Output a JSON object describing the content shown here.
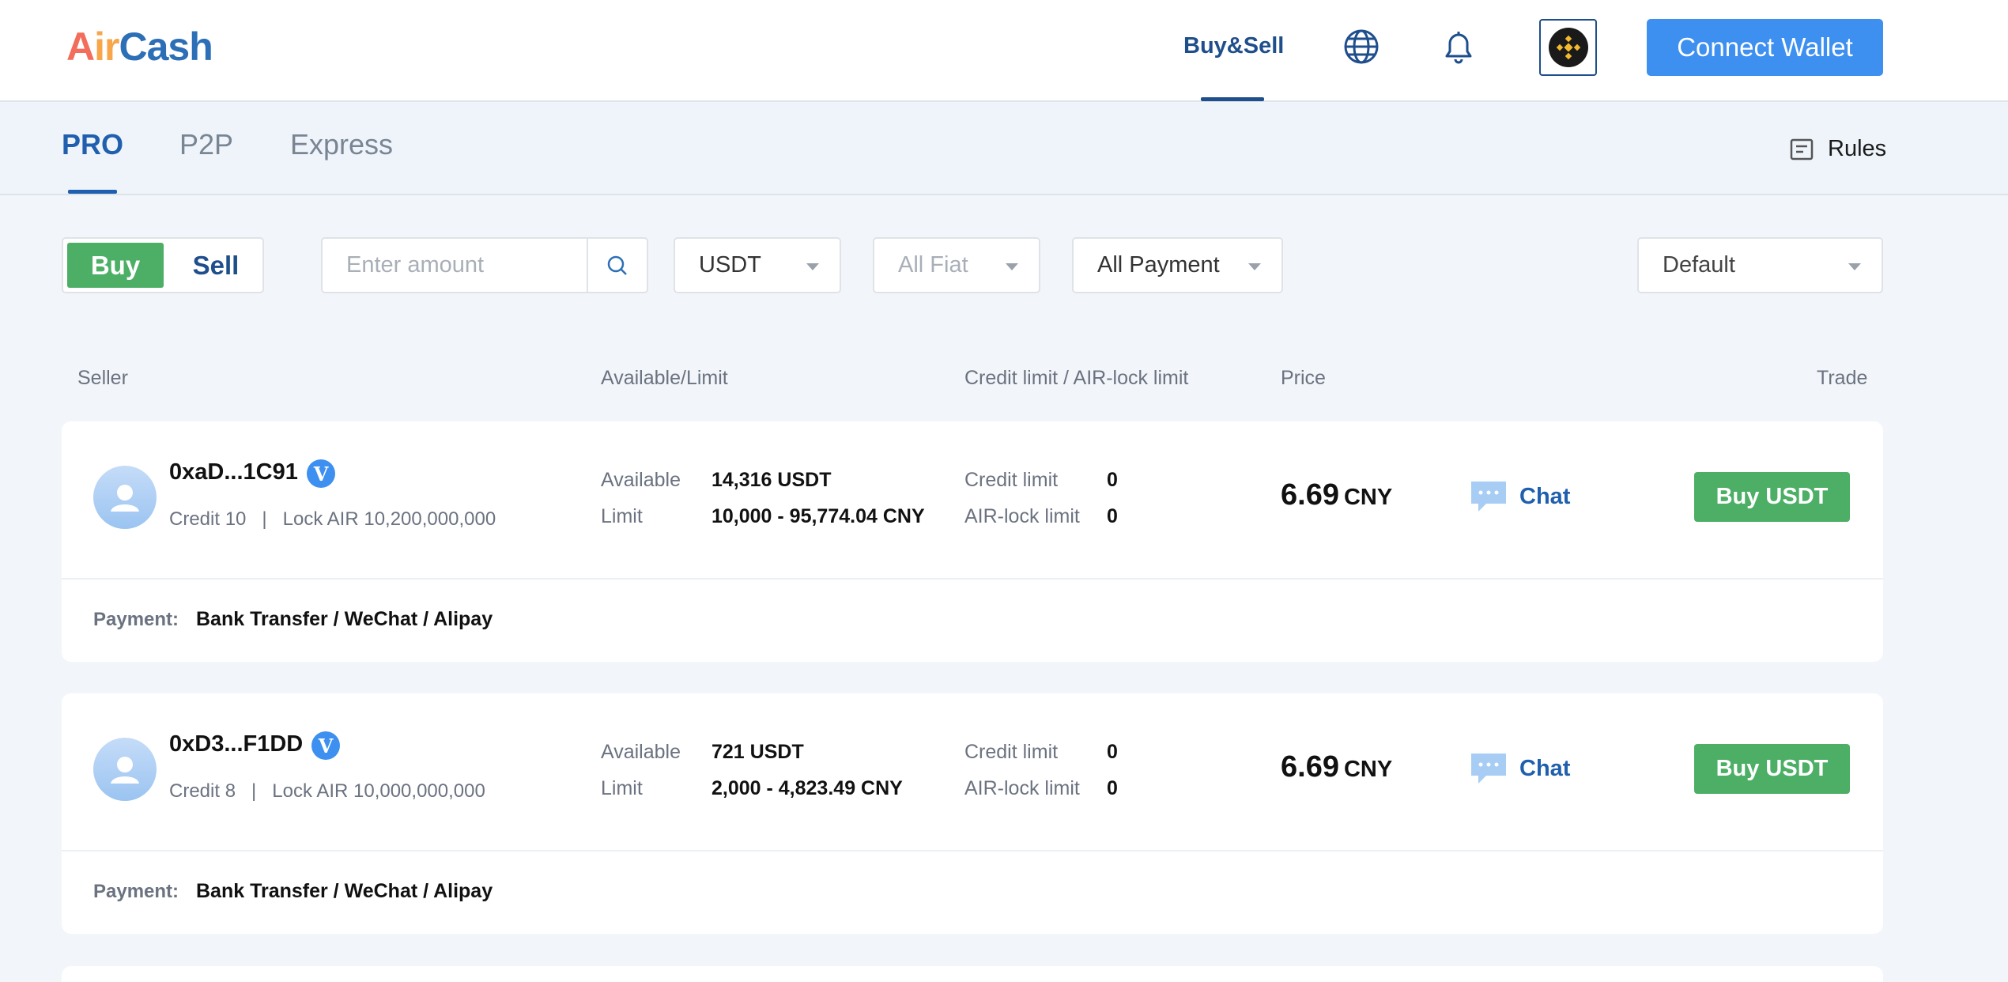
{
  "header": {
    "logo_part1": "A",
    "logo_part2": "ir",
    "logo_part3": "Cash",
    "nav_buysell": "Buy&Sell",
    "connect_label": "Connect Wallet",
    "icons": [
      "globe-icon",
      "bell-icon",
      "bnb-avatar-icon"
    ]
  },
  "tabs": {
    "items": [
      "PRO",
      "P2P",
      "Express"
    ],
    "active": "PRO",
    "rules_label": "Rules"
  },
  "filters": {
    "buy_label": "Buy",
    "sell_label": "Sell",
    "amount_placeholder": "Enter amount",
    "asset": "USDT",
    "fiat": "All Fiat",
    "payment": "All Payment",
    "sort": "Default"
  },
  "table": {
    "headers": {
      "seller": "Seller",
      "available": "Available/Limit",
      "credit": "Credit limit / AIR-lock limit",
      "price": "Price",
      "trade": "Trade"
    },
    "labels": {
      "available": "Available",
      "limit": "Limit",
      "credit_limit": "Credit limit",
      "airlock_limit": "AIR-lock limit",
      "chat": "Chat",
      "payment": "Payment:"
    },
    "rows": [
      {
        "seller": "0xaD...1C91",
        "verified": "V",
        "meta": "Credit 10   |   Lock AIR 10,200,000,000",
        "available": "14,316 USDT",
        "limit": "10,000 - 95,774.04 CNY",
        "credit_limit": "0",
        "airlock_limit": "0",
        "price": "6.69",
        "currency": "CNY",
        "trade_label": "Buy USDT",
        "payment": "Bank Transfer / WeChat / Alipay"
      },
      {
        "seller": "0xD3...F1DD",
        "verified": "V",
        "meta": "Credit 8   |   Lock AIR 10,000,000,000",
        "available": "721 USDT",
        "limit": "2,000 - 4,823.49 CNY",
        "credit_limit": "0",
        "airlock_limit": "0",
        "price": "6.69",
        "currency": "CNY",
        "trade_label": "Buy USDT",
        "payment": "Bank Transfer / WeChat / Alipay"
      }
    ]
  }
}
